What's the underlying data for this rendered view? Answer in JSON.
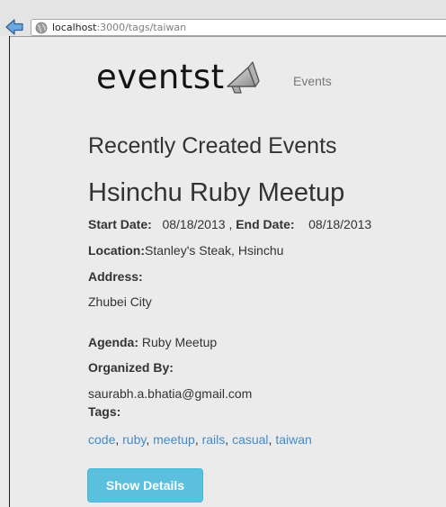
{
  "browser": {
    "url_host": "localhost",
    "url_path": ":3000/tags/taiwan"
  },
  "header": {
    "logo_text": "eventst",
    "nav_events": "Events"
  },
  "main": {
    "heading": "Recently Created Events",
    "event": {
      "title": "Hsinchu Ruby Meetup",
      "start_label": "Start Date:",
      "start_value": "08/18/2013",
      "separator": ",",
      "end_label": "End Date:",
      "end_value": "08/18/2013",
      "location_label": "Location:",
      "location_value": "Stanley's Steak, Hsinchu",
      "address_label": "Address:",
      "address_value": "Zhubei City",
      "agenda_label": "Agenda:",
      "agenda_value": "Ruby Meetup",
      "organized_label": "Organized By:",
      "organized_value": "saurabh.a.bhatia@gmail.com",
      "tags_label": "Tags:",
      "tags": [
        "code",
        "ruby",
        "meetup",
        "rails",
        "casual",
        "taiwan"
      ],
      "tag_separator": ",",
      "show_details_label": "Show Details"
    }
  },
  "colors": {
    "link": "#428bca",
    "button": "#5bc0de",
    "background": "#ebebeb"
  }
}
